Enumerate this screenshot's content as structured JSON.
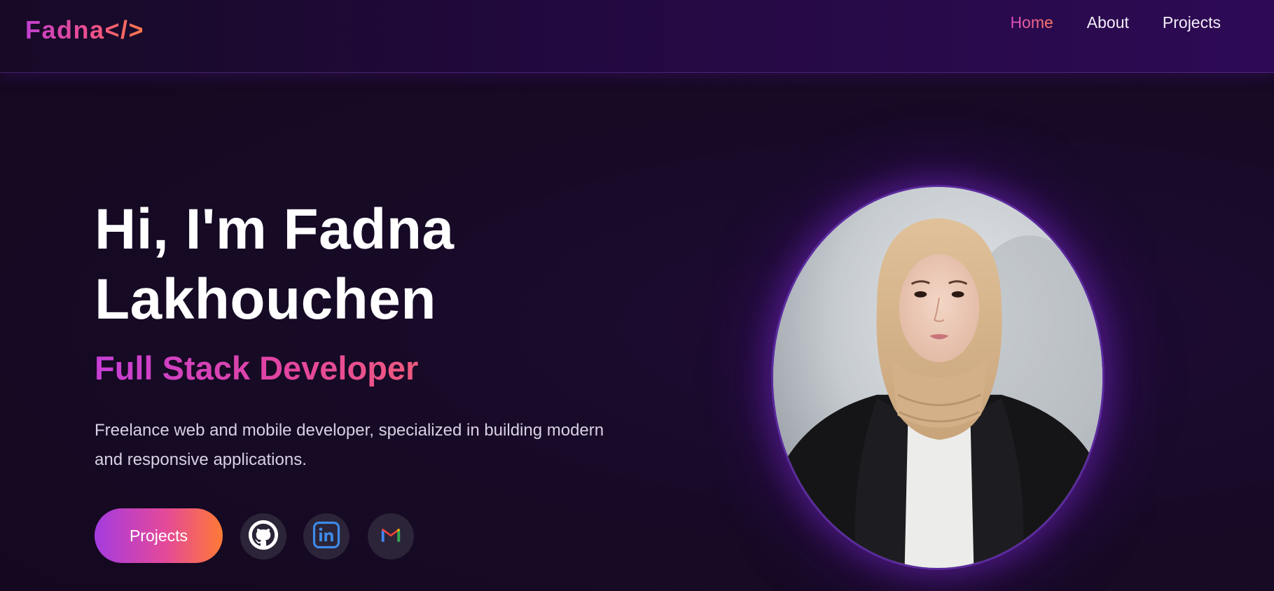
{
  "nav": {
    "logo": "Fadna</>",
    "links": [
      {
        "label": "Home",
        "active": true
      },
      {
        "label": "About",
        "active": false
      },
      {
        "label": "Projects",
        "active": false
      }
    ]
  },
  "hero": {
    "title_line1": "Hi, I'm Fadna",
    "title_line2": "Lakhouchen",
    "subtitle": "Full Stack Developer",
    "description": "Freelance web and mobile developer, specialized in building modern and responsive applications.",
    "cta_label": "Projects"
  },
  "social": {
    "github_icon": "github-icon",
    "linkedin_icon": "linkedin-icon",
    "gmail_icon": "gmail-icon"
  },
  "colors": {
    "background": "#170a26",
    "accent_start": "#a43be0",
    "accent_mid": "#e4499a",
    "accent_end": "#ff7a35"
  }
}
